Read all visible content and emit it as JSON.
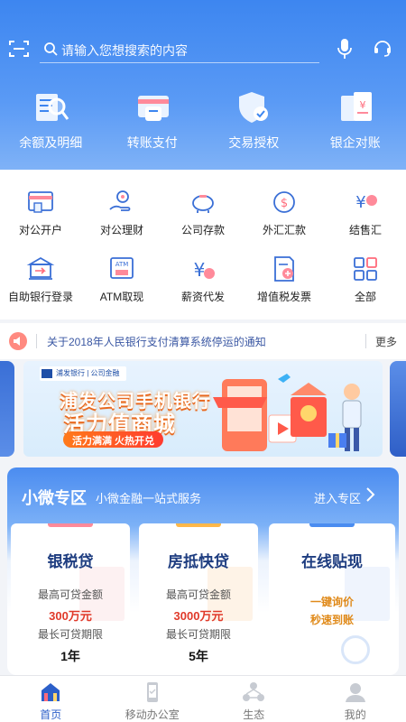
{
  "search": {
    "placeholder": "请输入您想搜索的内容"
  },
  "hero_tiles": [
    {
      "label": "余额及明细",
      "icon": "balance-detail-icon"
    },
    {
      "label": "转账支付",
      "icon": "transfer-icon"
    },
    {
      "label": "交易授权",
      "icon": "authorize-shield-icon"
    },
    {
      "label": "银企对账",
      "icon": "reconcile-icon"
    }
  ],
  "quick_grid": [
    {
      "label": "对公开户",
      "icon": "account-open-icon"
    },
    {
      "label": "对公理财",
      "icon": "wealth-icon"
    },
    {
      "label": "公司存款",
      "icon": "piggy-bank-icon"
    },
    {
      "label": "外汇汇款",
      "icon": "forex-icon"
    },
    {
      "label": "结售汇",
      "icon": "exchange-settle-icon"
    },
    {
      "label": "自助银行登录",
      "icon": "bank-building-icon"
    },
    {
      "label": "ATM取现",
      "icon": "atm-icon"
    },
    {
      "label": "薪资代发",
      "icon": "salary-icon"
    },
    {
      "label": "增值税发票",
      "icon": "invoice-icon"
    },
    {
      "label": "全部",
      "icon": "grid-all-icon"
    }
  ],
  "notice": {
    "text": "关于2018年人民银行支付清算系统停运的通知",
    "more": "更多"
  },
  "banner": {
    "line1": "浦发公司手机银行",
    "line2": "活力值商城",
    "pill": "活力满满 火热开兑",
    "logo_text": "浦发银行 | 公司金融"
  },
  "micro_zone": {
    "title": "小微专区",
    "subtitle": "小微金融一站式服务",
    "enter": "进入专区",
    "cards": [
      {
        "name": "银税贷",
        "label1": "最高可贷金额",
        "value1": "300万元",
        "label2": "最长可贷期限",
        "value2": "1年"
      },
      {
        "name": "房抵快贷",
        "label1": "最高可贷金额",
        "value1": "3000万元",
        "label2": "最长可贷期限",
        "value2": "5年"
      },
      {
        "name": "在线贴现",
        "cta1": "一键询价",
        "cta2": "秒速到账"
      }
    ]
  },
  "nav": [
    {
      "label": "首页",
      "icon": "home-icon",
      "active": true
    },
    {
      "label": "移动办公室",
      "icon": "mobile-office-icon",
      "active": false
    },
    {
      "label": "生态",
      "icon": "ecosystem-icon",
      "active": false
    },
    {
      "label": "我的",
      "icon": "profile-icon",
      "active": false
    }
  ],
  "colors": {
    "primary": "#3d86f0",
    "nav_active": "#2c5fc9",
    "value_red": "#e03a2a",
    "cta_orange": "#e08a1a"
  }
}
